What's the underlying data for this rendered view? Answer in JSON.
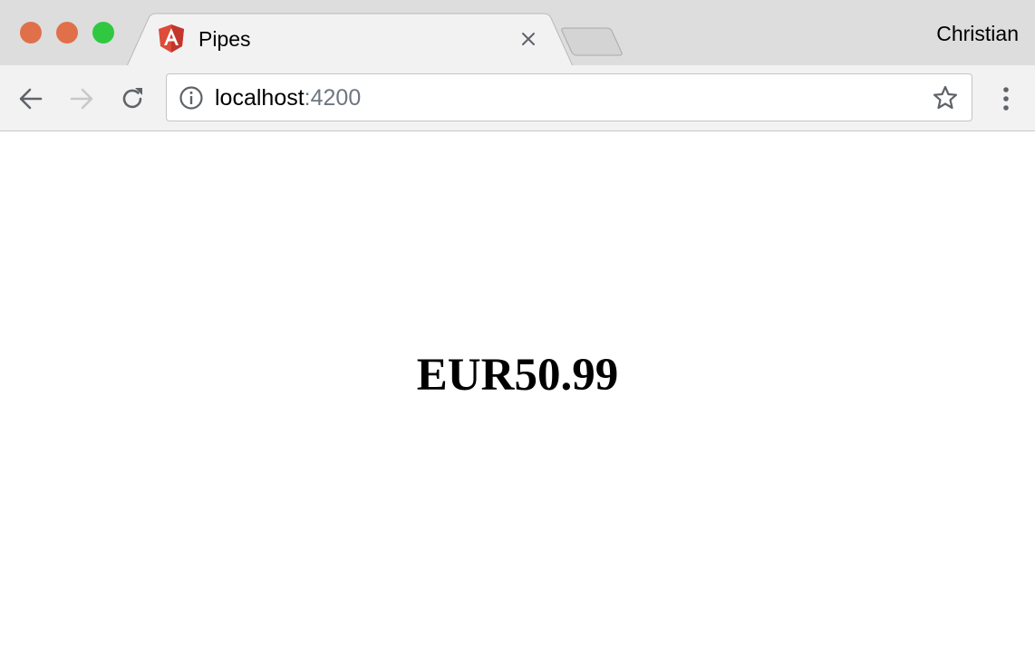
{
  "window": {
    "traffic_lights": {
      "close_color": "#e0704a",
      "minimize_color": "#e0704a",
      "maximize_color": "#2fc840"
    }
  },
  "tabs": [
    {
      "title": "Pipes",
      "favicon": "angular-logo-icon",
      "active": true,
      "close_icon": "close-icon"
    }
  ],
  "new_tab_button": {
    "icon": "new-tab-icon"
  },
  "profile": {
    "name": "Christian"
  },
  "toolbar": {
    "back_icon": "arrow-left-icon",
    "forward_icon": "arrow-right-icon",
    "forward_enabled": false,
    "reload_icon": "reload-icon",
    "menu_icon": "vertical-dots-icon"
  },
  "address_bar": {
    "security_icon": "info-icon",
    "host": "localhost",
    "port": ":4200",
    "bookmark_icon": "star-icon"
  },
  "page": {
    "heading": "EUR50.99"
  },
  "colors": {
    "tabstrip_bg": "#dddddd",
    "active_tab_bg": "#f2f2f2",
    "toolbar_bg": "#f2f2f2",
    "angular_red": "#dd4b39",
    "icon_gray": "#5f6368",
    "disabled_icon": "#c8c8c8"
  }
}
